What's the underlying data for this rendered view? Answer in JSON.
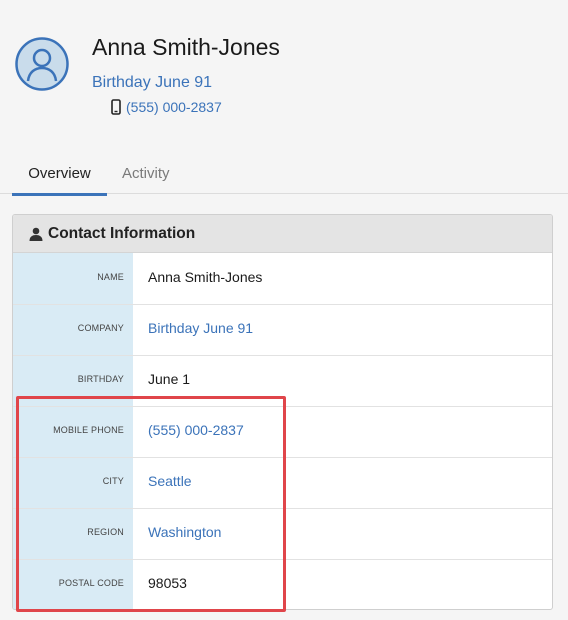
{
  "header": {
    "name": "Anna Smith-Jones",
    "company": "Birthday June 91",
    "phone": "(555) 000-2837"
  },
  "tabs": [
    {
      "label": "Overview",
      "active": true
    },
    {
      "label": "Activity",
      "active": false
    }
  ],
  "card": {
    "title": "Contact Information",
    "rows": [
      {
        "label": "NAME",
        "value": "Anna Smith-Jones",
        "link": false
      },
      {
        "label": "COMPANY",
        "value": "Birthday June 91",
        "link": true
      },
      {
        "label": "BIRTHDAY",
        "value": "June 1",
        "link": false
      },
      {
        "label": "MOBILE PHONE",
        "value": "(555) 000-2837",
        "link": true
      },
      {
        "label": "CITY",
        "value": "Seattle",
        "link": true
      },
      {
        "label": "REGION",
        "value": "Washington",
        "link": true
      },
      {
        "label": "POSTAL CODE",
        "value": "98053",
        "link": false
      }
    ]
  },
  "colors": {
    "accent": "#3b73b9",
    "label_column": "#d9ebf5",
    "highlight": "#e0454a"
  },
  "icons": {
    "avatar": "user-avatar-icon",
    "phone": "mobile-phone-icon",
    "card_header": "person-icon"
  }
}
